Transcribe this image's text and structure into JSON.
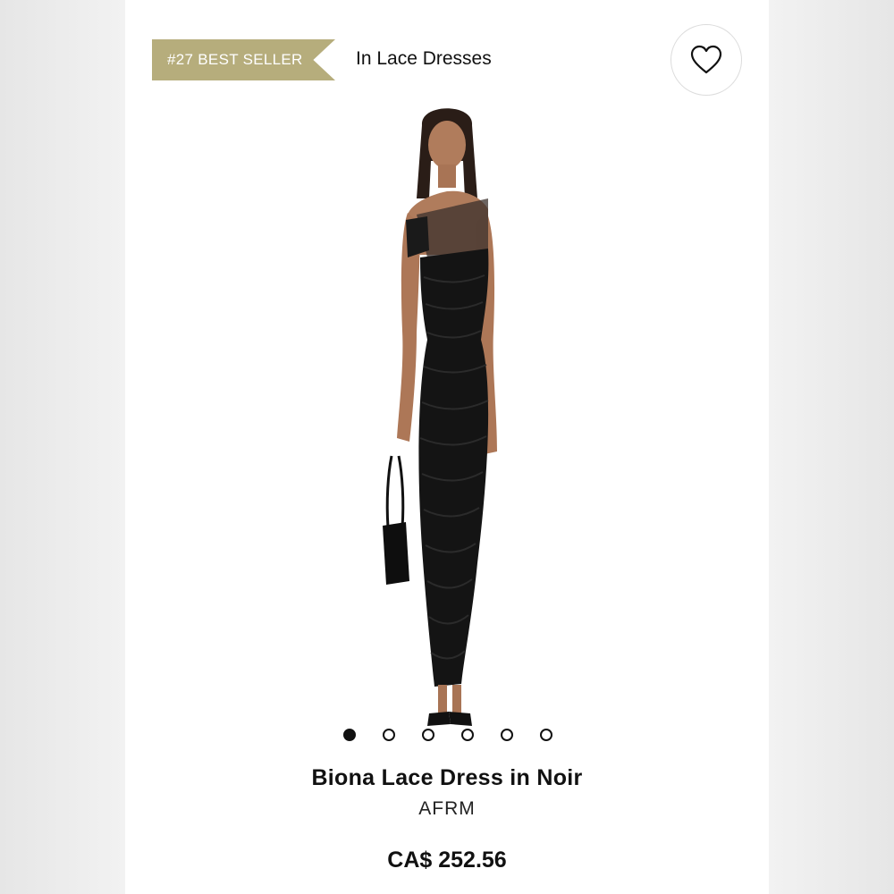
{
  "badge": {
    "text": "#27 BEST SELLER",
    "color": "#b6ad7c"
  },
  "category": {
    "text": "In Lace Dresses"
  },
  "wishlist": {
    "icon": "heart-icon"
  },
  "gallery": {
    "image_count": 6,
    "active_index": 0
  },
  "product": {
    "name": "Biona Lace Dress in Noir",
    "brand": "AFRM",
    "price": "CA$ 252.56"
  }
}
